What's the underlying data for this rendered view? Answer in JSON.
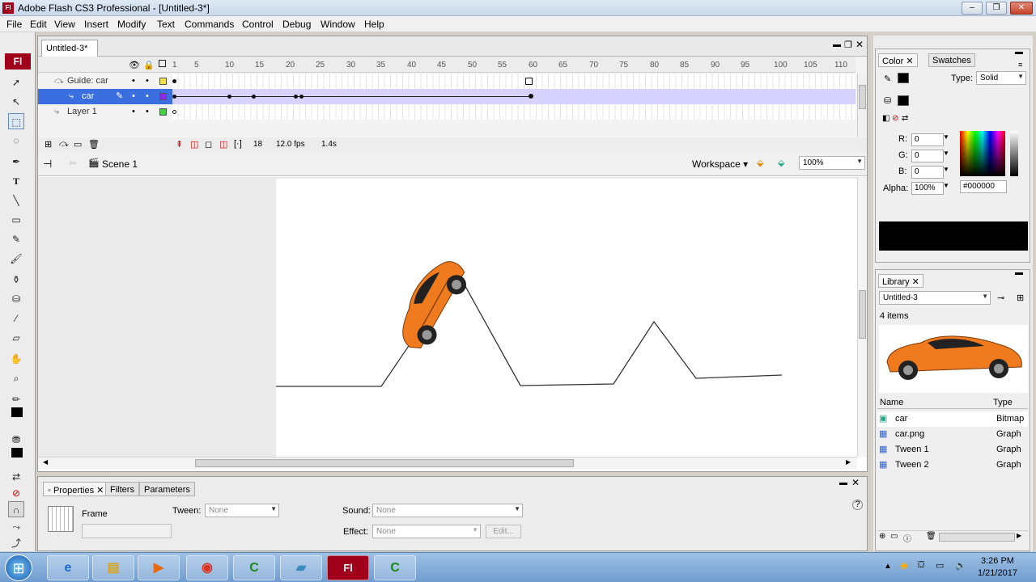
{
  "window": {
    "title": "Adobe Flash CS3 Professional - [Untitled-3*]",
    "icon": "Fl",
    "controls": [
      "minimize",
      "restore",
      "close"
    ]
  },
  "menu": [
    "File",
    "Edit",
    "View",
    "Insert",
    "Modify",
    "Text",
    "Commands",
    "Control",
    "Debug",
    "Window",
    "Help"
  ],
  "tools": {
    "logo": "Fl"
  },
  "document": {
    "tab": "Untitled-3*",
    "ruler": [
      "1",
      "5",
      "10",
      "15",
      "20",
      "25",
      "30",
      "35",
      "40",
      "45",
      "50",
      "55",
      "60",
      "65",
      "70",
      "75",
      "80",
      "85",
      "90",
      "95",
      "100",
      "105",
      "110"
    ],
    "layers": [
      {
        "name": "Guide: car",
        "color": "#f0e050"
      },
      {
        "name": "car",
        "color": "#8a2be2",
        "selected": true
      },
      {
        "name": "Layer 1",
        "color": "#44cc44"
      }
    ],
    "footer": {
      "current_frame": "18",
      "fps": "12.0 fps",
      "time": "1.4s"
    },
    "scene": "Scene 1",
    "workspace": "Workspace",
    "zoom": "100%"
  },
  "properties": {
    "tabs": [
      "Properties",
      "Filters",
      "Parameters"
    ],
    "type": "Frame",
    "tween_label": "Tween:",
    "tween": "None",
    "sound_label": "Sound:",
    "sound": "None",
    "effect_label": "Effect:",
    "effect": "None",
    "edit": "Edit..."
  },
  "color": {
    "tabs": [
      "Color",
      "Swatches"
    ],
    "type_label": "Type:",
    "type": "Solid",
    "r_label": "R:",
    "r": "0",
    "g_label": "G:",
    "g": "0",
    "b_label": "B:",
    "b": "0",
    "alpha_label": "Alpha:",
    "alpha": "100%",
    "hex": "#000000"
  },
  "library": {
    "tab": "Library",
    "doc": "Untitled-3",
    "count": "4 items",
    "col_name": "Name",
    "col_type": "Type",
    "items": [
      {
        "name": "car",
        "type": "Bitmap"
      },
      {
        "name": "car.png",
        "type": "Graph"
      },
      {
        "name": "Tween 1",
        "type": "Graph"
      },
      {
        "name": "Tween 2",
        "type": "Graph"
      }
    ]
  },
  "taskbar": {
    "time": "3:26 PM",
    "date": "1/21/2017"
  }
}
